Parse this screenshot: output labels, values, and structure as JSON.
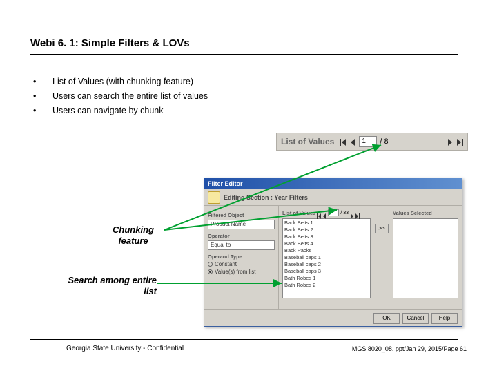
{
  "title": "Webi 6. 1: Simple Filters & LOVs",
  "bullets": {
    "b1": "List of Values (with chunking feature)",
    "b2": "Users can search the entire list of values",
    "b3": "Users can navigate by chunk"
  },
  "labels": {
    "chunking": "Chunking feature",
    "search": "Search among entire list"
  },
  "lov_pager": {
    "label": "List of Values",
    "page": "1",
    "total": "/ 8"
  },
  "dialog": {
    "title": "Filter Editor",
    "section": "Editing Section : Year Filters",
    "filtered_object_label": "Filtered Object",
    "filtered_object": "Product Name",
    "operator_label": "Operator",
    "operator": "Equal to",
    "operand_type_label": "Operand Type",
    "constant": "Constant",
    "values_from_list": "Value(s) from list",
    "lov_label": "List of Values",
    "lov_page": "1",
    "lov_total": "/ 33",
    "values_selected_label": "Values Selected",
    "items": [
      "Back Belts 1",
      "Back Belts 2",
      "Back Belts 3",
      "Back Belts 4",
      "Back Packs",
      "Baseball caps 1",
      "Baseball caps 2",
      "Baseball caps 3",
      "Bath Robes 1",
      "Bath Robes 2"
    ],
    "move_add": ">>",
    "ok": "OK",
    "cancel": "Cancel",
    "help": "Help"
  },
  "footer": {
    "left": "Georgia State University - Confidential",
    "right": "MGS 8020_08. ppt/Jan 29, 2015/Page 61"
  },
  "colors": {
    "arrow": "#00a030"
  }
}
